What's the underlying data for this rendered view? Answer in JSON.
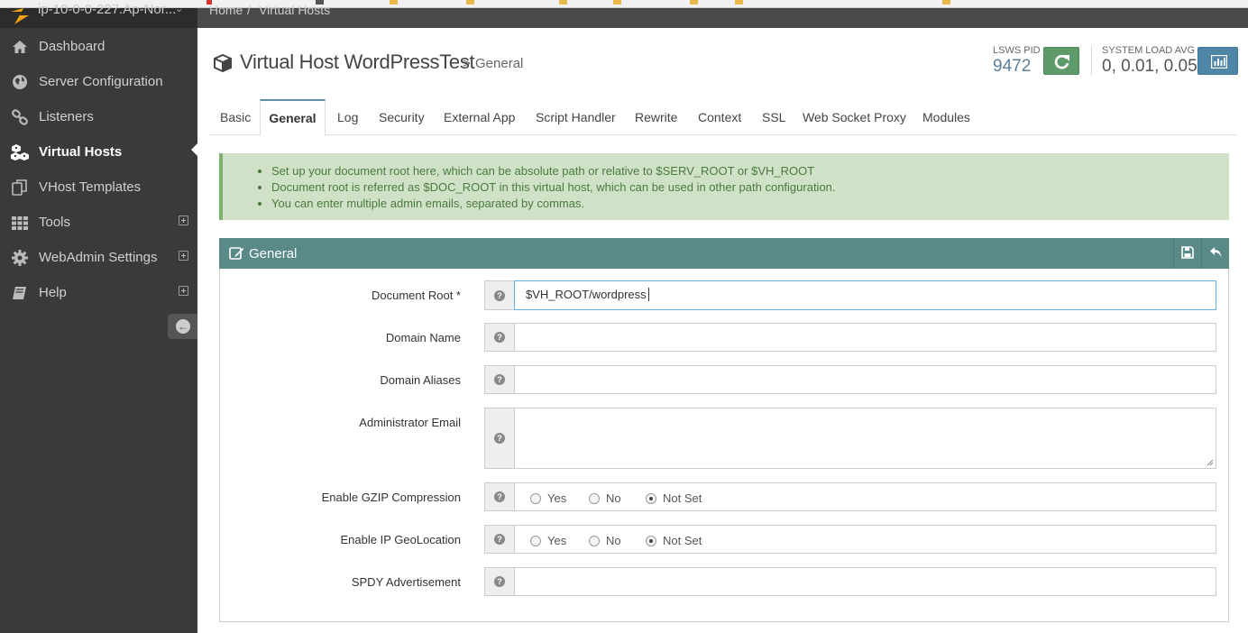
{
  "sidebar": {
    "host": "ip-10-0-0-227.Ap-Nor...",
    "items": [
      {
        "label": "Dashboard",
        "icon": "home-icon"
      },
      {
        "label": "Server Configuration",
        "icon": "globe-icon"
      },
      {
        "label": "Listeners",
        "icon": "link-icon"
      },
      {
        "label": "Virtual Hosts",
        "icon": "cubes-icon",
        "active": true
      },
      {
        "label": "VHost Templates",
        "icon": "copy-icon"
      },
      {
        "label": "Tools",
        "icon": "grid-icon",
        "expandable": true
      },
      {
        "label": "WebAdmin Settings",
        "icon": "gear-icon",
        "expandable": true
      },
      {
        "label": "Help",
        "icon": "book-icon",
        "expandable": true
      }
    ]
  },
  "breadcrumb": {
    "home": "Home",
    "sep": "/",
    "current": "Virtual Hosts"
  },
  "page": {
    "title": "Virtual Host WordPressTest",
    "sep": ">",
    "subtitle": "General"
  },
  "status": {
    "pid_label": "LSWS PID",
    "pid_value": "9472",
    "load_label": "SYSTEM LOAD AVG",
    "load_value": "0, 0.01, 0.05"
  },
  "tabs": [
    "Basic",
    "General",
    "Log",
    "Security",
    "External App",
    "Script Handler",
    "Rewrite",
    "Context",
    "SSL",
    "Web Socket Proxy",
    "Modules"
  ],
  "active_tab": "General",
  "info": [
    "Set up your document root here, which can be absolute path or relative to $SERV_ROOT or $VH_ROOT",
    "Document root is referred as $DOC_ROOT in this virtual host, which can be used in other path configuration.",
    "You can enter multiple admin emails, separated by commas."
  ],
  "panel": {
    "title": "General",
    "fields": {
      "doc_root": {
        "label": "Document Root *",
        "value": "$VH_ROOT/wordpress"
      },
      "domain_name": {
        "label": "Domain Name",
        "value": ""
      },
      "domain_aliases": {
        "label": "Domain Aliases",
        "value": ""
      },
      "admin_email": {
        "label": "Administrator Email",
        "value": ""
      },
      "gzip": {
        "label": "Enable GZIP Compression",
        "options": [
          "Yes",
          "No",
          "Not Set"
        ],
        "selected": "Not Set"
      },
      "geoloc": {
        "label": "Enable IP GeoLocation",
        "options": [
          "Yes",
          "No",
          "Not Set"
        ],
        "selected": "Not Set"
      },
      "spdy": {
        "label": "SPDY Advertisement",
        "value": ""
      }
    }
  },
  "colors": {
    "sidebar_bg": "#3a3a3a",
    "panel_header": "#5a8a88",
    "info_bg": "#cfe2c8",
    "restart_green": "#5f9b6a",
    "stats_blue": "#4f86a8",
    "pid_value": "#5a7f9b"
  }
}
